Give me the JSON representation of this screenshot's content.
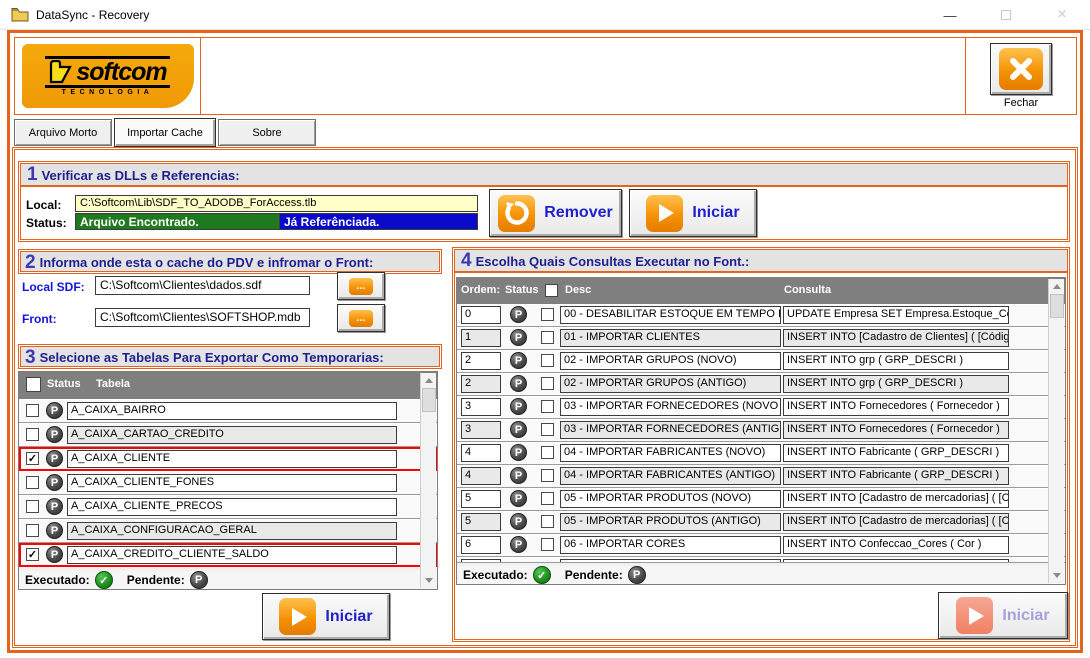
{
  "window": {
    "title": "DataSync - Recovery",
    "minimize": "—",
    "close": "×"
  },
  "brand": {
    "logo_text": "softcom",
    "logo_sub": "TECNOLOGIA"
  },
  "close_panel": {
    "label": "Fechar"
  },
  "tabs": {
    "tab1": "Arquivo Morto",
    "tab2": "Importar Cache",
    "tab3": "Sobre",
    "active": "Importar Cache"
  },
  "colors": {
    "accent_orange": "#E4641C",
    "status_green": "#1F7A1F",
    "status_blue": "#0A0ACA",
    "field_yellow": "#FFFFC8",
    "highlight_red": "#FF0000",
    "header_gray": "#7F7F7F",
    "title_navy": "#1F1F8F",
    "button_text_blue": "#2020CC"
  },
  "section1": {
    "number": "1",
    "title": "Verificar as DLLs e Referencias:",
    "local_label": "Local:",
    "local_value": "C:\\Softcom\\Lib\\SDF_TO_ADODB_ForAccess.tlb",
    "status_label": "Status:",
    "status_found": "Arquivo Encontrado.",
    "status_ref": "Já Referênciada.",
    "remover_label": "Remover",
    "iniciar_label": "Iniciar"
  },
  "section2": {
    "number": "2",
    "title": "Informa onde esta o cache do PDV e infromar o Front:",
    "local_sdf_label": "Local SDF:",
    "local_sdf_value": "C:\\Softcom\\Clientes\\dados.sdf",
    "front_label": "Front:",
    "front_value": "C:\\Softcom\\Clientes\\SOFTSHOP.mdb",
    "browse_label": "..."
  },
  "section3": {
    "number": "3",
    "title": "Selecione as Tabelas Para Exportar Como Temporarias:",
    "header": {
      "status": "Status",
      "tabela": "Tabela"
    },
    "rows": [
      {
        "check": "",
        "name": "A_CAIXA_BAIRRO"
      },
      {
        "check": "",
        "name": "A_CAIXA_CARTAO_CREDITO"
      },
      {
        "check": "✓",
        "name": "A_CAIXA_CLIENTE"
      },
      {
        "check": "",
        "name": "A_CAIXA_CLIENTE_FONES"
      },
      {
        "check": "",
        "name": "A_CAIXA_CLIENTE_PRECOS"
      },
      {
        "check": "",
        "name": "A_CAIXA_CONFIGURACAO_GERAL"
      },
      {
        "check": "✓",
        "name": "A_CAIXA_CREDITO_CLIENTE_SALDO"
      }
    ],
    "legend": {
      "executado": "Executado:",
      "pendente": "Pendente:"
    },
    "iniciar_label": "Iniciar"
  },
  "section4": {
    "number": "4",
    "title": "Escolha Quais Consultas Executar no Font.:",
    "header": {
      "ordem": "Ordem:",
      "status": "Status",
      "desc": "Desc",
      "consulta": "Consulta"
    },
    "rows": [
      {
        "ordem": "0",
        "check": "",
        "desc": "00 - DESABILITAR ESTOQUE EM TEMPO I",
        "consulta": "UPDATE Empresa SET Empresa.Estoque_Co"
      },
      {
        "ordem": "1",
        "check": "",
        "desc": "01 - IMPORTAR CLIENTES",
        "consulta": "INSERT INTO [Cadastro de Clientes] ( [Código"
      },
      {
        "ordem": "2",
        "check": "",
        "desc": "02 -  IMPORTAR GRUPOS (NOVO)",
        "consulta": "INSERT INTO grp ( GRP_DESCRI )"
      },
      {
        "ordem": "2",
        "check": "",
        "desc": "02 -  IMPORTAR GRUPOS (ANTIGO)",
        "consulta": "INSERT INTO grp ( GRP_DESCRI )"
      },
      {
        "ordem": "3",
        "check": "",
        "desc": "03 - IMPORTAR FORNECEDORES (NOVO",
        "consulta": "INSERT INTO Fornecedores ( Fornecedor )"
      },
      {
        "ordem": "3",
        "check": "",
        "desc": "03 - IMPORTAR FORNECEDORES (ANTIG",
        "consulta": "INSERT INTO Fornecedores ( Fornecedor )"
      },
      {
        "ordem": "4",
        "check": "",
        "desc": "04 - IMPORTAR FABRICANTES (NOVO)",
        "consulta": "INSERT INTO Fabricante ( GRP_DESCRI )"
      },
      {
        "ordem": "4",
        "check": "",
        "desc": "04 - IMPORTAR FABRICANTES (ANTIGO)",
        "consulta": "INSERT INTO Fabricante ( GRP_DESCRI )"
      },
      {
        "ordem": "5",
        "check": "",
        "desc": "05 - IMPORTAR PRODUTOS (NOVO)",
        "consulta": "INSERT INTO [Cadastro de mercadorias] ( [Có"
      },
      {
        "ordem": "5",
        "check": "",
        "desc": "05 - IMPORTAR PRODUTOS (ANTIGO)",
        "consulta": "INSERT INTO [Cadastro de mercadorias] ( [Có"
      },
      {
        "ordem": "6",
        "check": "",
        "desc": "06 - IMPORTAR CORES",
        "consulta": "INSERT INTO Confeccao_Cores ( Cor )"
      }
    ],
    "legend": {
      "executado": "Executado:",
      "pendente": "Pendente:"
    },
    "iniciar_label": "Iniciar"
  }
}
